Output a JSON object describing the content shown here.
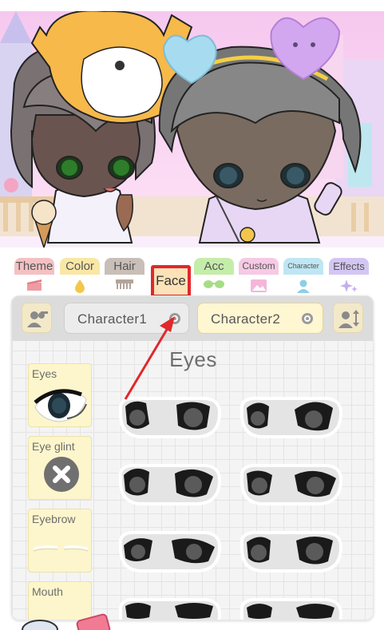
{
  "tabs": [
    {
      "label": "Theme",
      "icon": "clapper-icon",
      "color": "#f3c1c3"
    },
    {
      "label": "Color",
      "icon": "drop-icon",
      "color": "#f9e7a6"
    },
    {
      "label": "Hair",
      "icon": "comb-icon",
      "color": "#c9bfb8"
    },
    {
      "label": "Face",
      "icon": "face-icon",
      "color": "#fbe2b8"
    },
    {
      "label": "Acc",
      "icon": "glasses-icon",
      "color": "#c5edaa"
    },
    {
      "label": "Custom",
      "icon": "image-icon",
      "color": "#f6c9e4"
    },
    {
      "label": "Character",
      "icon": "person-icon",
      "color": "#bfe6f3"
    },
    {
      "label": "Effects",
      "icon": "sparkle-icon",
      "color": "#d3c6f3"
    }
  ],
  "selected_tab": "Face",
  "characters": {
    "first": "Character1",
    "second": "Character2"
  },
  "section_title": "Eyes",
  "categories": [
    "Eyes",
    "Eye glint",
    "Eyebrow",
    "Mouth"
  ],
  "colors": {
    "highlight": "#e0282c",
    "panel": "#f4f4f4",
    "category_bg": "#fdf6cc"
  }
}
